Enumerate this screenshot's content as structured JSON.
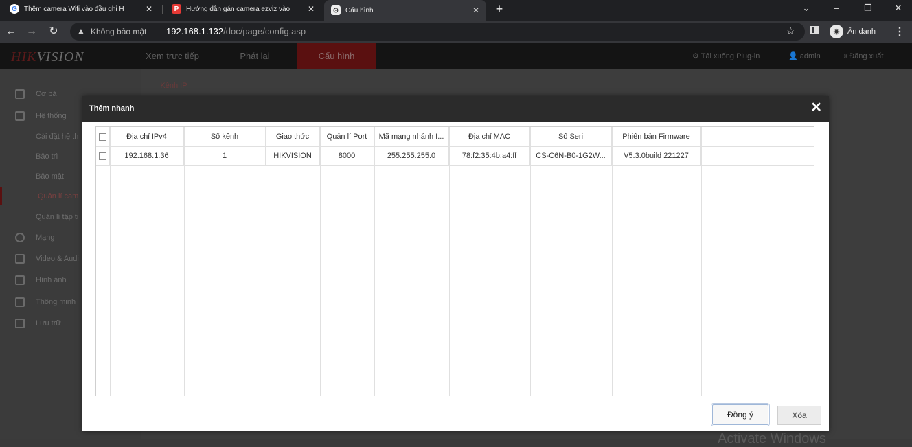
{
  "browser": {
    "tabs": [
      {
        "title": "Thêm camera Wifi vào đầu ghi H",
        "favicon": "google-icon",
        "favicon_color": "#4285f4"
      },
      {
        "title": "Hướng dẫn gán camera ezviz vào",
        "favicon": "p-logo-icon",
        "favicon_color": "#e53935"
      },
      {
        "title": "Cấu hình",
        "favicon": "page-icon",
        "favicon_color": "#ffffff"
      }
    ],
    "new_tab": "+",
    "security_label": "Không bảo mật",
    "url_host": "192.168.1.132",
    "url_path": "/doc/page/config.asp",
    "profile_label": "Ẩn danh"
  },
  "app": {
    "logo_prefix": "HIK",
    "logo_suffix": "VISION",
    "nav": [
      "Xem trực tiếp",
      "Phát lại",
      "Cấu hình"
    ],
    "nav_active": 2,
    "header_right": {
      "plugin": "Tải xuống Plug-in",
      "user": "admin",
      "logout": "Đăng xuất"
    },
    "sidebar": [
      {
        "label": "Cơ bả",
        "icon": "monitor-icon"
      },
      {
        "label": "Hệ thống",
        "icon": "calendar-icon"
      },
      {
        "label": "Cài đặt hệ th",
        "sub": true
      },
      {
        "label": "Bảo trì",
        "sub": true
      },
      {
        "label": "Bảo mật",
        "sub": true
      },
      {
        "label": "Quản lí cam",
        "sub": true,
        "active": true
      },
      {
        "label": "Quản lí tập ti",
        "sub": true
      },
      {
        "label": "Mạng",
        "icon": "globe-icon"
      },
      {
        "label": "Video & Audi",
        "icon": "video-icon"
      },
      {
        "label": "Hình ảnh",
        "icon": "image-icon"
      },
      {
        "label": "Thông minh",
        "icon": "smart-icon"
      },
      {
        "label": "Lưu trữ",
        "icon": "storage-icon"
      }
    ],
    "content_tab": "Kênh IP",
    "watermark": "Activate Windows"
  },
  "modal": {
    "title": "Thêm nhanh",
    "close": "✕",
    "columns": [
      "Địa chỉ IPv4",
      "Số kênh",
      "Giao thức",
      "Quản lí Port",
      "Mã mạng nhánh I...",
      "Địa chỉ MAC",
      "Số Seri",
      "Phiên bản Firmware",
      ""
    ],
    "rows": [
      {
        "checked": false,
        "cells": [
          "192.168.1.36",
          "1",
          "HIKVISION",
          "8000",
          "255.255.255.0",
          "78:f2:35:4b:a4:ff",
          "CS-C6N-B0-1G2W...",
          "V5.3.0build 221227",
          ""
        ]
      }
    ],
    "ok_label": "Đồng ý",
    "delete_label": "Xóa"
  },
  "colors": {
    "accent": "#5a1010",
    "modal_header": "#2b2b2b"
  }
}
